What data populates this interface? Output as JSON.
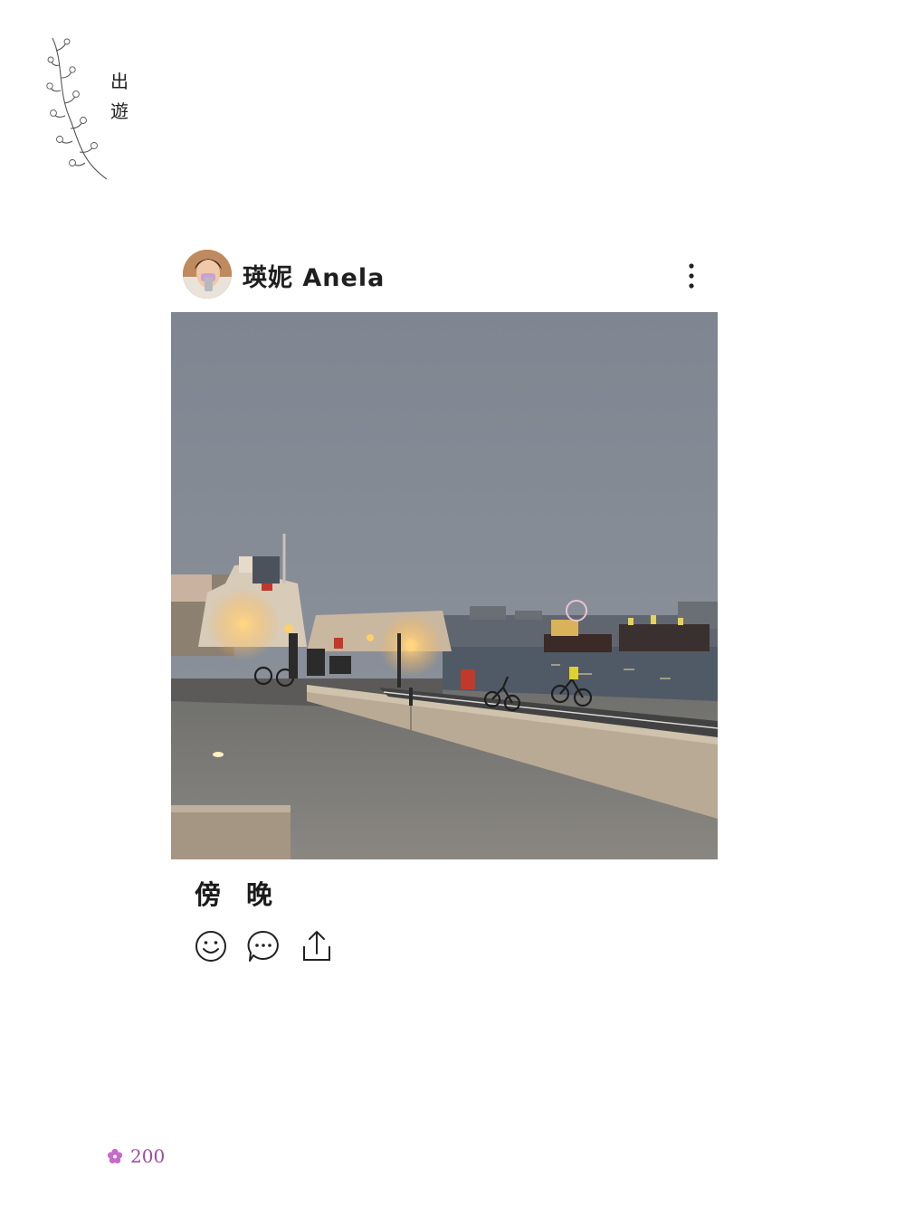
{
  "chapter": {
    "line1": "出",
    "line2": "遊"
  },
  "post": {
    "username": "瑛妮 Anela",
    "caption": "傍晚"
  },
  "icons": {
    "more": "more-vertical-icon",
    "react": "smiley-icon",
    "comment": "chat-bubble-icon",
    "share": "share-icon"
  },
  "folio": {
    "page_number": "200"
  },
  "colors": {
    "folio_accent": "#a04aa0",
    "text": "#1a1a1a"
  }
}
